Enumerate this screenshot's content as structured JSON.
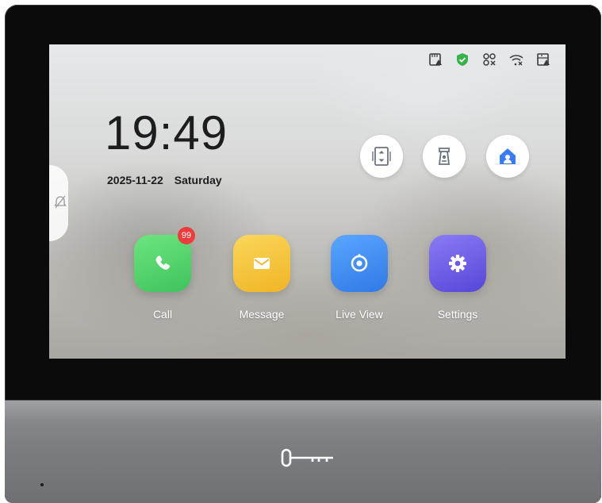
{
  "clock": {
    "time": "19:49",
    "date": "2025-11-22",
    "weekday": "Saturday"
  },
  "status_icons": [
    "sd-card-alert-icon",
    "shield-check-icon",
    "link-off-icon",
    "wifi-off-icon",
    "storage-alert-icon"
  ],
  "side_panel": {
    "icon": "mute-off-icon"
  },
  "quick_actions": [
    {
      "name": "elevator",
      "icon": "elevator-icon"
    },
    {
      "name": "door-station",
      "icon": "door-station-icon"
    },
    {
      "name": "home",
      "icon": "home-person-icon"
    }
  ],
  "apps": [
    {
      "label": "Call",
      "icon": "phone-icon",
      "color": "#4fd26b",
      "badge": "99"
    },
    {
      "label": "Message",
      "icon": "envelope-icon",
      "color": "#f7c531"
    },
    {
      "label": "Live View",
      "icon": "camera-icon",
      "color": "#3f8ff0"
    },
    {
      "label": "Settings",
      "icon": "gear-icon",
      "color": "#6d5ce8"
    }
  ],
  "colors": {
    "badge": "#ee3b3b",
    "shield": "#35b24a",
    "quick_icon": "#6b7280",
    "home_icon": "#3b7cf5"
  },
  "hardware": {
    "unlock_icon": "key-icon"
  }
}
